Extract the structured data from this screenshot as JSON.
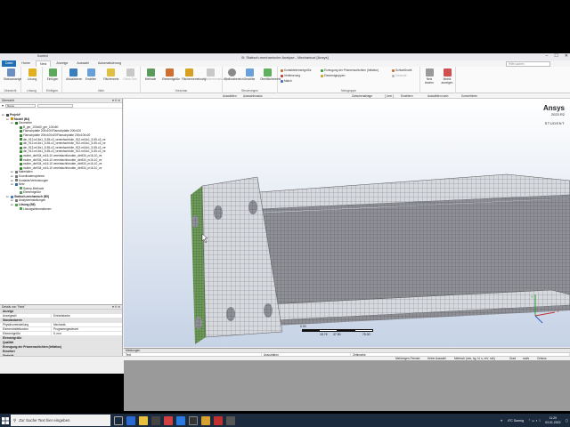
{
  "window": {
    "title": "B: Statisch-mechanische Analyse - Mechanical [Ansys]",
    "context_tab": "Kontext",
    "controls": [
      "–",
      "☐",
      "✕"
    ]
  },
  "ribbon_tabs": [
    "Datei",
    "Home",
    "Netz",
    "Anzeige",
    "Auswahl",
    "Automatisierung"
  ],
  "search_placeholder": "Hilfe suchen",
  "ribbon": {
    "groups": [
      {
        "label": "Übersicht",
        "buttons": [
          "Statusanzeige"
        ]
      },
      {
        "label": "Lösung",
        "buttons": [
          "Lösung"
        ]
      },
      {
        "label": "Einfügen",
        "buttons": [
          "Einfügen"
        ]
      },
      {
        "label": "Netz",
        "buttons": [
          "Aktualisieren",
          "Erstellen",
          "Flächennetz",
          "Clean Geo"
        ]
      },
      {
        "label": "Vorschau",
        "buttons": [
          "Methode",
          "Elementgröße",
          "Flächenvernetzung",
          "Flächenvernetzung"
        ]
      },
      {
        "label": "Steuerungen",
        "buttons": [
          "Einflussbereich",
          "Gewölbe",
          "Oberflächennetz"
        ]
      },
      {
        "label": "Netzgruppe",
        "buttons": []
      }
    ],
    "small_items": [
      "Kontaktelementgröße",
      "Verfeinerung",
      "Match",
      "Erzeugung der Prismenschichten (Inflation)",
      "Elementgruppen",
      "Schweißnaht",
      "Gewinde",
      "Verbinden",
      "Netz ändern",
      "Metrik anzeigen"
    ]
  },
  "toolbar2": [
    "Auswählen",
    "Auswahlmodus",
    "Zwischenablage",
    "[ Leer ]",
    "Erweitern",
    "Auswählen nach",
    "Konvertieren"
  ],
  "tree_panel": {
    "title": "Übersicht",
    "filter_label": "Name",
    "items": [
      {
        "label": "Projekt*",
        "level": 0,
        "bold": true,
        "color": "#4a4a4a"
      },
      {
        "label": "Modell (B4)",
        "level": 1,
        "bold": true,
        "color": "#d88a00"
      },
      {
        "label": "Geometrie",
        "level": 2,
        "bold": false,
        "color": "#2a7a2a"
      },
      {
        "label": "B_ger_100x60_ger_100x80",
        "level": 3,
        "bold": false,
        "color": "#3a8a3a"
      },
      {
        "label": "Flanschplatte 200x100\\Flanschplatte 200x100",
        "level": 3,
        "bold": false,
        "color": "#3a8a3a"
      },
      {
        "label": "Flanschplatte 200x100x20\\Flanschplatte 200x100x20",
        "level": 3,
        "bold": false,
        "color": "#3a8a3a"
      },
      {
        "label": "din_912-m16x1_5-55-c3_vereinfacht\\din_912-m16x1_5-55-c3_ve",
        "level": 3,
        "bold": false,
        "color": "#3a8a3a"
      },
      {
        "label": "din_912-m16x1_5-55-c3_vereinfacht\\din_912-m16x1_5-55-c3_ve",
        "level": 3,
        "bold": false,
        "color": "#3a8a3a"
      },
      {
        "label": "din_912-m16x1_5-55-c3_vereinfacht\\din_912-m16x1_5-55-c3_ve",
        "level": 3,
        "bold": false,
        "color": "#3a8a3a"
      },
      {
        "label": "din_912-m16x1_5-55-c3_vereinfacht\\din_912-m16x1_5-55-c3_ve",
        "level": 3,
        "bold": false,
        "color": "#3a8a3a"
      },
      {
        "label": "mutter_din934_m16-10 vereinfacht\\mutter_din934_m16-10_ve",
        "level": 3,
        "bold": false,
        "color": "#3a8a3a"
      },
      {
        "label": "mutter_din934_m16-10 vereinfacht\\mutter_din934_m16-10_ve",
        "level": 3,
        "bold": false,
        "color": "#3a8a3a"
      },
      {
        "label": "mutter_din934_m16-10 vereinfacht\\mutter_din934_m16-10_ve",
        "level": 3,
        "bold": false,
        "color": "#3a8a3a"
      },
      {
        "label": "mutter_din934_m16-10 vereinfacht\\mutter_din934_m16-10_ve",
        "level": 3,
        "bold": false,
        "color": "#3a8a3a"
      },
      {
        "label": "Materialien",
        "level": 2,
        "bold": false,
        "color": "#777777"
      },
      {
        "label": "Koordinatensysteme",
        "level": 2,
        "bold": false,
        "color": "#777777"
      },
      {
        "label": "Kontakte/Verbindungen",
        "level": 2,
        "bold": false,
        "color": "#777777"
      },
      {
        "label": "Netz",
        "level": 2,
        "bold": false,
        "color": "#2a6aa8"
      },
      {
        "label": "Sweep-Methode",
        "level": 3,
        "bold": false,
        "color": "#5a9a5a"
      },
      {
        "label": "Elementgröße",
        "level": 3,
        "bold": false,
        "color": "#5a9a5a"
      },
      {
        "label": "Statisch-mechanisch (B5)",
        "level": 1,
        "bold": true,
        "color": "#4a7ac8"
      },
      {
        "label": "Analyseeinstellungen",
        "level": 2,
        "bold": false,
        "color": "#777777"
      },
      {
        "label": "Lösung (B6)",
        "level": 2,
        "bold": true,
        "color": "#4aa84a"
      },
      {
        "label": "Lösungsinformationen",
        "level": 3,
        "bold": false,
        "color": "#4aa84a"
      }
    ]
  },
  "details_panel": {
    "title": "Details von \"Netz\"",
    "rows": [
      {
        "type": "cat",
        "key": "Anzeige",
        "value": ""
      },
      {
        "type": "row",
        "key": "Anzeigestil",
        "value": "Einheitsfarbe"
      },
      {
        "type": "cat",
        "key": "Standardwerte",
        "value": ""
      },
      {
        "type": "row",
        "key": "Physikvoreinstellung",
        "value": "Mechanik"
      },
      {
        "type": "row",
        "key": "Elementmittelknoten",
        "value": "Programmgesteuert"
      },
      {
        "type": "row",
        "key": "Elementgröße",
        "value": "5, mm"
      },
      {
        "type": "cat",
        "key": "Elementgröße",
        "value": ""
      },
      {
        "type": "cat",
        "key": "Qualität",
        "value": ""
      },
      {
        "type": "cat",
        "key": "Erzeugung der Prismenschichten (Inflation)",
        "value": ""
      },
      {
        "type": "cat",
        "key": "Erweitert",
        "value": ""
      },
      {
        "type": "cat",
        "key": "Statistik",
        "value": ""
      }
    ]
  },
  "viewport": {
    "logo": "Ansys",
    "version": "2023 R2",
    "edition": "STUDENT",
    "scale": {
      "ticks": [
        "0.00",
        "37.50",
        "75.00"
      ],
      "sub": "18.75",
      "unit": "(mm)"
    }
  },
  "messages": {
    "title": "Meldungen",
    "columns": [
      "Text",
      "Assoziation",
      "Zeitmarke"
    ]
  },
  "statusbar": {
    "items": [
      "Meldungen-Fenster",
      "Keine Auswahl",
      "Metrisch (mm, kg, N, s, mV, mA)",
      "Grad",
      "rad/s",
      "Celsius"
    ]
  },
  "taskbar": {
    "search_placeholder": "Zur Suche Text hier eingeben",
    "weather": "4°C Sonnig",
    "time": "11:20",
    "date": "03.01.2022"
  }
}
